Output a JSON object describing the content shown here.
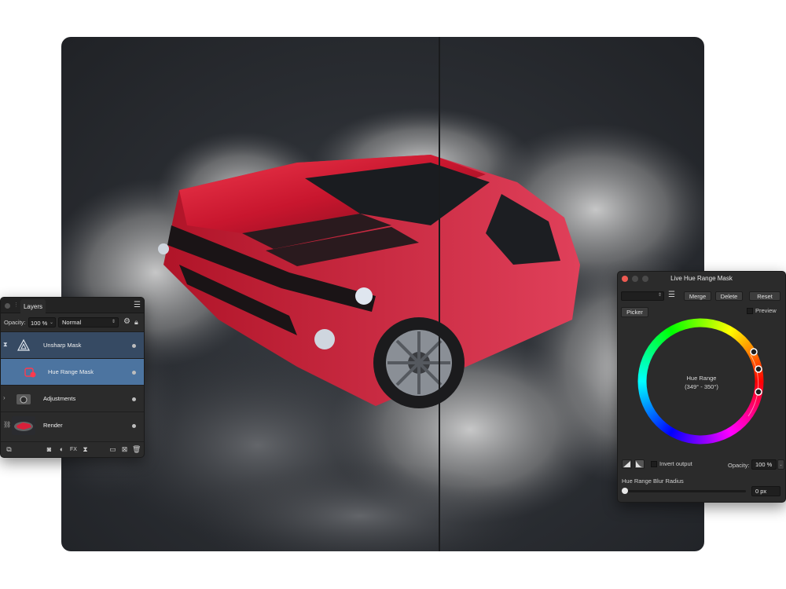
{
  "layers_panel": {
    "tab_label": "Layers",
    "opacity_label": "Opacity:",
    "opacity_value": "100 %",
    "blend_mode": "Normal",
    "layers": [
      {
        "name": "Unsharp Mask",
        "state": "selected"
      },
      {
        "name": "Hue Range Mask",
        "state": "active"
      },
      {
        "name": "Adjustments",
        "state": "normal"
      },
      {
        "name": "Render",
        "state": "normal"
      }
    ]
  },
  "hue_range_panel": {
    "title": "Live Hue Range Mask",
    "merge_label": "Merge",
    "delete_label": "Delete",
    "reset_label": "Reset",
    "picker_label": "Picker",
    "preview_label": "Preview",
    "hue_range_label": "Hue Range",
    "hue_range_value": "(349° - 350°)",
    "invert_label": "Invert output",
    "opacity_label": "Opacity:",
    "opacity_value": "100 %",
    "blur_label": "Hue Range Blur Radius",
    "blur_value": "0 px",
    "blur_fraction": 0
  },
  "colors": {
    "car_red": "#d8203a",
    "selected_row": "#364a63",
    "active_row": "#4c74a0",
    "close_red": "#ee5a52"
  }
}
